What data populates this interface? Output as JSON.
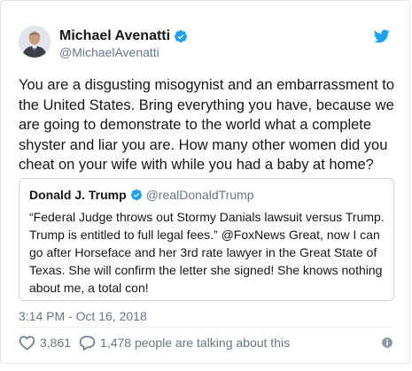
{
  "author": {
    "name": "Michael Avenatti",
    "handle": "@MichaelAvenatti"
  },
  "tweet": {
    "text": "You are a disgusting misogynist and an embarrassment to the United States. Bring everything you have, because we are going to demonstrate to the world what a complete shyster and liar you are. How many other women did you cheat on your wife with while you had a baby at home?"
  },
  "quoted_tweet": {
    "name": "Donald J. Trump",
    "handle": "@realDonaldTrump",
    "text": "“Federal Judge throws out Stormy Danials lawsuit versus Trump. Trump is entitled to full legal fees.” @FoxNews Great, now I can go after Horseface and her 3rd rate lawyer in the Great State of Texas. She will confirm the letter she signed! She knows nothing about me, a total con!"
  },
  "timestamp": "3:14 PM - Oct 16, 2018",
  "actions": {
    "likes": "3,861",
    "conversation": "1,478 people are talking about this"
  },
  "icons": {
    "brand": "twitter-bird-icon",
    "verified": "verified-badge-icon",
    "like": "heart-icon",
    "reply": "speech-bubble-icon",
    "info": "info-icon"
  },
  "colors": {
    "twitter_blue": "#1da1f2",
    "text_primary": "#14171a",
    "text_secondary": "#657786",
    "border": "#e1e8ed"
  }
}
